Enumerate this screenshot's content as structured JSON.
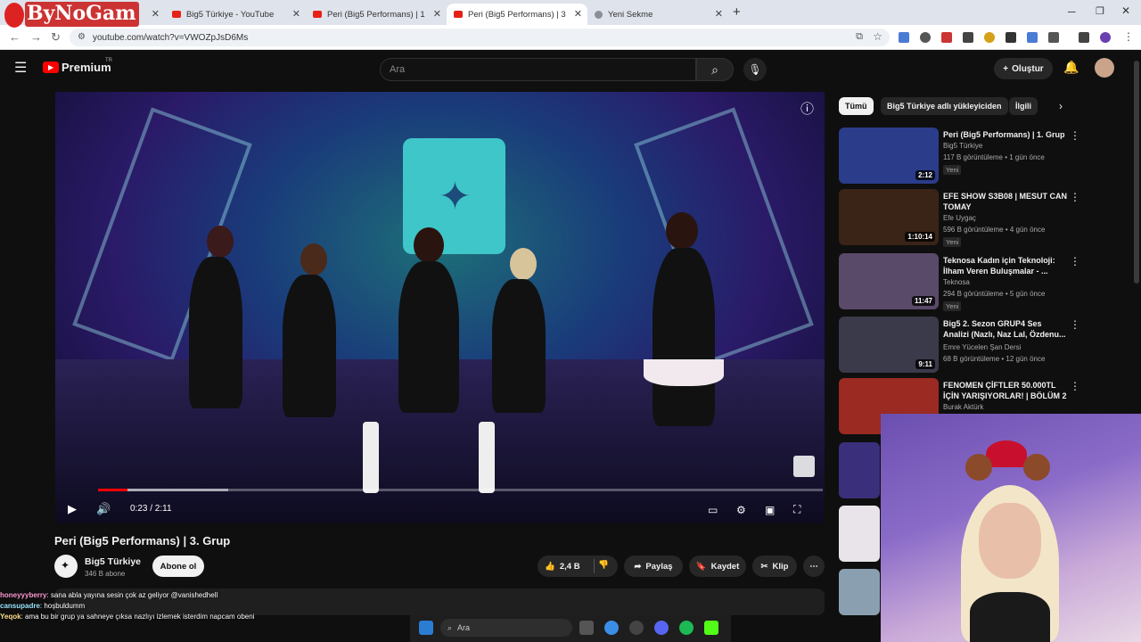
{
  "overlay": {
    "logo_text": "ByNoGam"
  },
  "tabs": [
    {
      "label": "",
      "active": false
    },
    {
      "label": "Big5 Türkiye - YouTube",
      "active": false
    },
    {
      "label": "Peri (Big5 Performans) | 1. Grup",
      "active": false
    },
    {
      "label": "Peri (Big5 Performans) | 3. Grup",
      "active": true
    },
    {
      "label": "Yeni Sekme",
      "active": false
    }
  ],
  "browser": {
    "url": "youtube.com/watch?v=VWOZpJsD6Ms"
  },
  "yt_header": {
    "brand": "Premium",
    "region": "TR",
    "search_placeholder": "Ara",
    "create_label": "Oluştur"
  },
  "player": {
    "time": "0:23 / 2:11",
    "progress_fraction": 0.18
  },
  "video": {
    "title": "Peri (Big5 Performans) | 3. Grup",
    "channel": "Big5 Türkiye",
    "subscribers": "346 B abone",
    "subscribe_label": "Abone ol",
    "likes": "2,4 B",
    "share_label": "Paylaş",
    "save_label": "Kaydet",
    "clip_label": "Klip"
  },
  "chips": [
    "Tümü",
    "Big5 Türkiye adlı yükleyiciden",
    "İlgili"
  ],
  "related": [
    {
      "title": "Peri (Big5 Performans) | 1. Grup",
      "channel": "Big5 Türkiye",
      "meta": "117 B görüntüleme • 1 gün önce",
      "badge": "Yeni",
      "duration": "2:12",
      "thumb_color": "#2a3c8a"
    },
    {
      "title": "EFE SHOW S3B08 | MESUT CAN TOMAY",
      "channel": "Efe Uygaç",
      "meta": "596 B görüntüleme • 4 gün önce",
      "badge": "Yeni",
      "duration": "1:10:14",
      "thumb_color": "#3a2418"
    },
    {
      "title": "Teknosa Kadın için Teknoloji: İlham Veren Buluşmalar - ...",
      "channel": "Teknosa",
      "meta": "294 B görüntüleme • 5 gün önce",
      "badge": "Yeni",
      "duration": "11:47",
      "thumb_color": "#5a4a6a"
    },
    {
      "title": "Big5 2. Sezon GRUP4 Ses Analizi (Nazlı, Naz Lal, Özdenu...",
      "channel": "Emre Yücelen Şan Dersi",
      "meta": "68 B görüntüleme • 12 gün önce",
      "badge": "",
      "duration": "9:11",
      "thumb_color": "#3a3a4a"
    },
    {
      "title": "FENOMEN ÇİFTLER 50.000TL İÇİN YARIŞIYORLAR! | BÖLÜM 2",
      "channel": "Burak Aktürk",
      "meta": "",
      "badge": "",
      "duration": "",
      "thumb_color": "#9a2a22"
    }
  ],
  "chat": [
    {
      "user": "honeyyyberry",
      "text": ": sana abla yayına sesin çok az geliyor @vanishedhell",
      "color": "#ff9ad5"
    },
    {
      "user": "cansupadre",
      "text": ": hoşbuldumm",
      "color": "#9ae5ff"
    },
    {
      "user": "Yeqok",
      "text": ": ama bu bir grup ya sahneye çıksa nazlıyı izlemek isterdim napcam obeni",
      "color": "#ffe08a"
    }
  ],
  "taskbar": {
    "search": "Ara"
  }
}
